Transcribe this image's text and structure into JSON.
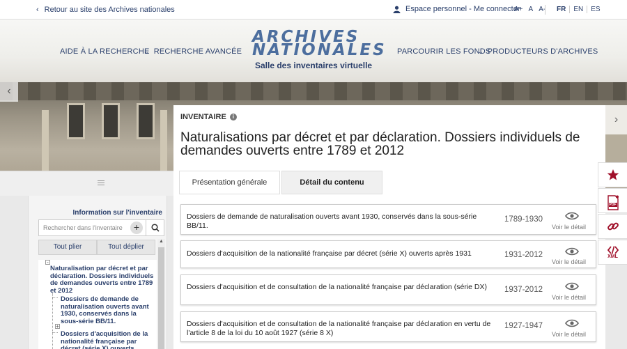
{
  "topbar": {
    "back_label": "Retour au site des Archives nationales",
    "account_label": "Espace personnel - Me connecter",
    "font_sizes": [
      "A+",
      "A",
      "A-"
    ],
    "languages": [
      "FR",
      "EN",
      "ES"
    ]
  },
  "header": {
    "nav_left": [
      "AIDE À LA RECHERCHE",
      "RECHERCHE AVANCÉE"
    ],
    "nav_right": [
      "PARCOURIR LES FONDS",
      "PRODUCTEURS D'ARCHIVES"
    ],
    "logo_line1": "ARCHIVES",
    "logo_line2": "NATIONALES",
    "logo_subtitle": "Salle des inventaires virtuelle"
  },
  "left_panel": {
    "title": "Information sur l'inventaire",
    "search_placeholder": "Rechercher dans l'inventaire",
    "collapse_all": "Tout plier",
    "expand_all": "Tout déplier",
    "tree": [
      "Naturalisation par décret et par déclaration. Dossiers individuels de demandes ouverts entre 1789 et 2012",
      "Dossiers de demande de naturalisation ouverts avant 1930, conservés dans la sous-série BB/11.",
      "Dossiers d'acquisition de la nationalité française par décret (série X) ouverts"
    ]
  },
  "main": {
    "badge": "INVENTAIRE",
    "title": "Naturalisations par décret et par déclaration. Dossiers individuels de demandes ouverts entre 1789 et 2012",
    "tabs": [
      "Présentation générale",
      "Détail du contenu"
    ],
    "active_tab": "Détail du contenu",
    "view_label": "Voir le détail",
    "rows": [
      {
        "text": "Dossiers de demande de naturalisation ouverts avant 1930, conservés dans la sous-série BB/11.",
        "dates": "1789-1930"
      },
      {
        "text": "Dossiers d'acquisition de la nationalité française par décret (série X) ouverts après 1931",
        "dates": "1931-2012"
      },
      {
        "text": "Dossiers d'acquisition et de consultation de la nationalité française par déclaration (série DX)",
        "dates": "1937-2012"
      },
      {
        "text": "Dossiers d'acquisition et de consultation de la nationalité française par déclaration en vertu de l'article 8 de la loi du 10 août 1927 (série 8 X)",
        "dates": "1927-1947"
      }
    ]
  },
  "side_tools": [
    {
      "name": "favorite",
      "label": ""
    },
    {
      "name": "pdf",
      "label": "PDF"
    },
    {
      "name": "link",
      "label": ""
    },
    {
      "name": "xml",
      "label": "XML"
    }
  ],
  "colors": {
    "accent": "#2a3f6b",
    "tool_red": "#a0102a"
  }
}
